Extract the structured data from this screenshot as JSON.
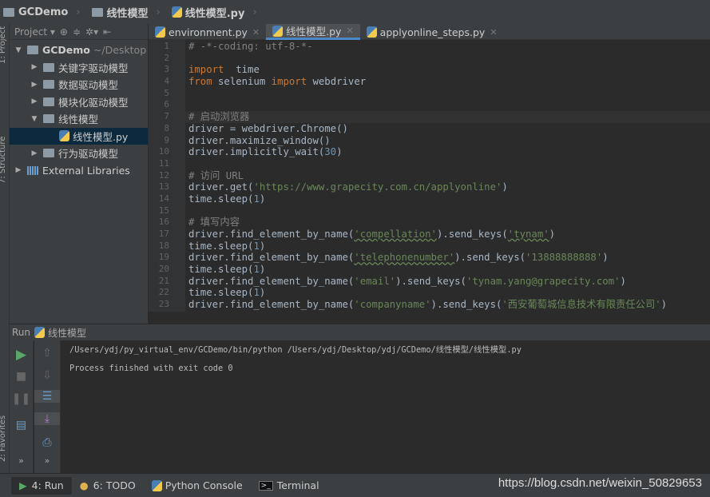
{
  "breadcrumb": [
    "GCDemo",
    "线性模型",
    "线性模型.py"
  ],
  "left_tool_windows": [
    "1: Project",
    "7: Structure",
    "2: Favorites"
  ],
  "project_bar": {
    "label": "Project"
  },
  "tree": [
    {
      "label": "GCDemo",
      "suffix": "~/Desktop",
      "depth": 0,
      "arrow": "▼",
      "icon": "folder"
    },
    {
      "label": "关键字驱动模型",
      "depth": 1,
      "arrow": "▶",
      "icon": "folder"
    },
    {
      "label": "数据驱动模型",
      "depth": 1,
      "arrow": "▶",
      "icon": "folder"
    },
    {
      "label": "模块化驱动模型",
      "depth": 1,
      "arrow": "▶",
      "icon": "folder"
    },
    {
      "label": "线性模型",
      "depth": 1,
      "arrow": "▼",
      "icon": "folder"
    },
    {
      "label": "线性模型.py",
      "depth": 2,
      "arrow": "",
      "icon": "python",
      "selected": true
    },
    {
      "label": "行为驱动模型",
      "depth": 1,
      "arrow": "▶",
      "icon": "folder"
    },
    {
      "label": "External Libraries",
      "depth": 0,
      "arrow": "▶",
      "icon": "library"
    }
  ],
  "tabs": [
    {
      "label": "environment.py",
      "active": false
    },
    {
      "label": "线性模型.py",
      "active": true
    },
    {
      "label": "applyonline_steps.py",
      "active": false
    }
  ],
  "code": [
    [
      [
        "cm",
        "# -*-coding: utf-8-*-"
      ]
    ],
    [],
    [
      [
        "kw",
        "import"
      ],
      [
        "",
        "  time"
      ]
    ],
    [
      [
        "kw",
        "from"
      ],
      [
        "",
        " selenium "
      ],
      [
        "kw",
        "import"
      ],
      [
        "",
        " webdriver"
      ]
    ],
    [],
    [],
    [
      [
        "cm",
        "# 启动浏览器"
      ]
    ],
    [
      [
        "",
        "driver = webdriver.Chrome()"
      ]
    ],
    [
      [
        "",
        "driver.maximize_window()"
      ]
    ],
    [
      [
        "",
        "driver.implicitly_wait("
      ],
      [
        "num",
        "30"
      ],
      [
        "",
        ")"
      ]
    ],
    [],
    [
      [
        "cm",
        "# 访问 URL"
      ]
    ],
    [
      [
        "",
        "driver.get("
      ],
      [
        "str",
        "'https://www.grapecity.com.cn/applyonline'"
      ],
      [
        "",
        ")"
      ]
    ],
    [
      [
        "",
        "time.sleep("
      ],
      [
        "num",
        "1"
      ],
      [
        "",
        ")"
      ]
    ],
    [],
    [
      [
        "cm",
        "# 填写内容"
      ]
    ],
    [
      [
        "",
        "driver.find_element_by_name("
      ],
      [
        "str ul",
        "'compellation'"
      ],
      [
        "",
        ").send_keys("
      ],
      [
        "str ul",
        "'tynam'"
      ],
      [
        "",
        ")"
      ]
    ],
    [
      [
        "",
        "time.sleep("
      ],
      [
        "num",
        "1"
      ],
      [
        "",
        ")"
      ]
    ],
    [
      [
        "",
        "driver.find_element_by_name("
      ],
      [
        "str ul",
        "'telephonenumber'"
      ],
      [
        "",
        ").send_keys("
      ],
      [
        "str",
        "'13888888888'"
      ],
      [
        "",
        ")"
      ]
    ],
    [
      [
        "",
        "time.sleep("
      ],
      [
        "num",
        "1"
      ],
      [
        "",
        ")"
      ]
    ],
    [
      [
        "",
        "driver.find_element_by_name("
      ],
      [
        "str",
        "'email'"
      ],
      [
        "",
        ").send_keys("
      ],
      [
        "str",
        "'tynam.yang@grapecity.com'"
      ],
      [
        "",
        ")"
      ]
    ],
    [
      [
        "",
        "time.sleep("
      ],
      [
        "num",
        "1"
      ],
      [
        "",
        ")"
      ]
    ],
    [
      [
        "",
        "driver.find_element_by_name("
      ],
      [
        "str",
        "'companyname'"
      ],
      [
        "",
        ").send_keys("
      ],
      [
        "str",
        "'西安葡萄城信息技术有限责任公司'"
      ],
      [
        "",
        ")"
      ]
    ]
  ],
  "run": {
    "label": "Run",
    "config": "线性模型",
    "console": [
      "/Users/ydj/py_virtual_env/GCDemo/bin/python /Users/ydj/Desktop/ydj/GCDemo/线性模型/线性模型.py",
      "",
      "Process finished with exit code 0"
    ]
  },
  "status_tabs": [
    {
      "label": "4: Run",
      "icon": "run-icon",
      "active": true
    },
    {
      "label": "6: TODO",
      "icon": "todo-icon"
    },
    {
      "label": "Python Console",
      "icon": "python-console-icon"
    },
    {
      "label": "Terminal",
      "icon": "terminal-icon"
    }
  ],
  "watermark": "https://blog.csdn.net/weixin_50829653",
  "colors": {
    "keyword": "#cc7832",
    "string": "#6a8759",
    "number": "#6897bb",
    "comment": "#808080",
    "text": "#a9b7c6",
    "run_green": "#59a869"
  }
}
